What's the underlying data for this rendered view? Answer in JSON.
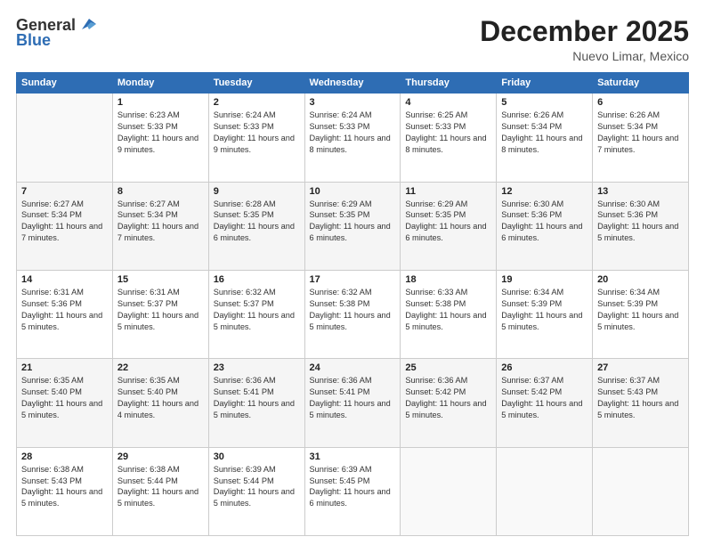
{
  "header": {
    "logo_general": "General",
    "logo_blue": "Blue",
    "month_title": "December 2025",
    "location": "Nuevo Limar, Mexico"
  },
  "days_of_week": [
    "Sunday",
    "Monday",
    "Tuesday",
    "Wednesday",
    "Thursday",
    "Friday",
    "Saturday"
  ],
  "weeks": [
    [
      {
        "day": "",
        "sunrise": "",
        "sunset": "",
        "daylight": ""
      },
      {
        "day": "1",
        "sunrise": "Sunrise: 6:23 AM",
        "sunset": "Sunset: 5:33 PM",
        "daylight": "Daylight: 11 hours and 9 minutes."
      },
      {
        "day": "2",
        "sunrise": "Sunrise: 6:24 AM",
        "sunset": "Sunset: 5:33 PM",
        "daylight": "Daylight: 11 hours and 9 minutes."
      },
      {
        "day": "3",
        "sunrise": "Sunrise: 6:24 AM",
        "sunset": "Sunset: 5:33 PM",
        "daylight": "Daylight: 11 hours and 8 minutes."
      },
      {
        "day": "4",
        "sunrise": "Sunrise: 6:25 AM",
        "sunset": "Sunset: 5:33 PM",
        "daylight": "Daylight: 11 hours and 8 minutes."
      },
      {
        "day": "5",
        "sunrise": "Sunrise: 6:26 AM",
        "sunset": "Sunset: 5:34 PM",
        "daylight": "Daylight: 11 hours and 8 minutes."
      },
      {
        "day": "6",
        "sunrise": "Sunrise: 6:26 AM",
        "sunset": "Sunset: 5:34 PM",
        "daylight": "Daylight: 11 hours and 7 minutes."
      }
    ],
    [
      {
        "day": "7",
        "sunrise": "Sunrise: 6:27 AM",
        "sunset": "Sunset: 5:34 PM",
        "daylight": "Daylight: 11 hours and 7 minutes."
      },
      {
        "day": "8",
        "sunrise": "Sunrise: 6:27 AM",
        "sunset": "Sunset: 5:34 PM",
        "daylight": "Daylight: 11 hours and 7 minutes."
      },
      {
        "day": "9",
        "sunrise": "Sunrise: 6:28 AM",
        "sunset": "Sunset: 5:35 PM",
        "daylight": "Daylight: 11 hours and 6 minutes."
      },
      {
        "day": "10",
        "sunrise": "Sunrise: 6:29 AM",
        "sunset": "Sunset: 5:35 PM",
        "daylight": "Daylight: 11 hours and 6 minutes."
      },
      {
        "day": "11",
        "sunrise": "Sunrise: 6:29 AM",
        "sunset": "Sunset: 5:35 PM",
        "daylight": "Daylight: 11 hours and 6 minutes."
      },
      {
        "day": "12",
        "sunrise": "Sunrise: 6:30 AM",
        "sunset": "Sunset: 5:36 PM",
        "daylight": "Daylight: 11 hours and 6 minutes."
      },
      {
        "day": "13",
        "sunrise": "Sunrise: 6:30 AM",
        "sunset": "Sunset: 5:36 PM",
        "daylight": "Daylight: 11 hours and 5 minutes."
      }
    ],
    [
      {
        "day": "14",
        "sunrise": "Sunrise: 6:31 AM",
        "sunset": "Sunset: 5:36 PM",
        "daylight": "Daylight: 11 hours and 5 minutes."
      },
      {
        "day": "15",
        "sunrise": "Sunrise: 6:31 AM",
        "sunset": "Sunset: 5:37 PM",
        "daylight": "Daylight: 11 hours and 5 minutes."
      },
      {
        "day": "16",
        "sunrise": "Sunrise: 6:32 AM",
        "sunset": "Sunset: 5:37 PM",
        "daylight": "Daylight: 11 hours and 5 minutes."
      },
      {
        "day": "17",
        "sunrise": "Sunrise: 6:32 AM",
        "sunset": "Sunset: 5:38 PM",
        "daylight": "Daylight: 11 hours and 5 minutes."
      },
      {
        "day": "18",
        "sunrise": "Sunrise: 6:33 AM",
        "sunset": "Sunset: 5:38 PM",
        "daylight": "Daylight: 11 hours and 5 minutes."
      },
      {
        "day": "19",
        "sunrise": "Sunrise: 6:34 AM",
        "sunset": "Sunset: 5:39 PM",
        "daylight": "Daylight: 11 hours and 5 minutes."
      },
      {
        "day": "20",
        "sunrise": "Sunrise: 6:34 AM",
        "sunset": "Sunset: 5:39 PM",
        "daylight": "Daylight: 11 hours and 5 minutes."
      }
    ],
    [
      {
        "day": "21",
        "sunrise": "Sunrise: 6:35 AM",
        "sunset": "Sunset: 5:40 PM",
        "daylight": "Daylight: 11 hours and 5 minutes."
      },
      {
        "day": "22",
        "sunrise": "Sunrise: 6:35 AM",
        "sunset": "Sunset: 5:40 PM",
        "daylight": "Daylight: 11 hours and 4 minutes."
      },
      {
        "day": "23",
        "sunrise": "Sunrise: 6:36 AM",
        "sunset": "Sunset: 5:41 PM",
        "daylight": "Daylight: 11 hours and 5 minutes."
      },
      {
        "day": "24",
        "sunrise": "Sunrise: 6:36 AM",
        "sunset": "Sunset: 5:41 PM",
        "daylight": "Daylight: 11 hours and 5 minutes."
      },
      {
        "day": "25",
        "sunrise": "Sunrise: 6:36 AM",
        "sunset": "Sunset: 5:42 PM",
        "daylight": "Daylight: 11 hours and 5 minutes."
      },
      {
        "day": "26",
        "sunrise": "Sunrise: 6:37 AM",
        "sunset": "Sunset: 5:42 PM",
        "daylight": "Daylight: 11 hours and 5 minutes."
      },
      {
        "day": "27",
        "sunrise": "Sunrise: 6:37 AM",
        "sunset": "Sunset: 5:43 PM",
        "daylight": "Daylight: 11 hours and 5 minutes."
      }
    ],
    [
      {
        "day": "28",
        "sunrise": "Sunrise: 6:38 AM",
        "sunset": "Sunset: 5:43 PM",
        "daylight": "Daylight: 11 hours and 5 minutes."
      },
      {
        "day": "29",
        "sunrise": "Sunrise: 6:38 AM",
        "sunset": "Sunset: 5:44 PM",
        "daylight": "Daylight: 11 hours and 5 minutes."
      },
      {
        "day": "30",
        "sunrise": "Sunrise: 6:39 AM",
        "sunset": "Sunset: 5:44 PM",
        "daylight": "Daylight: 11 hours and 5 minutes."
      },
      {
        "day": "31",
        "sunrise": "Sunrise: 6:39 AM",
        "sunset": "Sunset: 5:45 PM",
        "daylight": "Daylight: 11 hours and 6 minutes."
      },
      {
        "day": "",
        "sunrise": "",
        "sunset": "",
        "daylight": ""
      },
      {
        "day": "",
        "sunrise": "",
        "sunset": "",
        "daylight": ""
      },
      {
        "day": "",
        "sunrise": "",
        "sunset": "",
        "daylight": ""
      }
    ]
  ]
}
